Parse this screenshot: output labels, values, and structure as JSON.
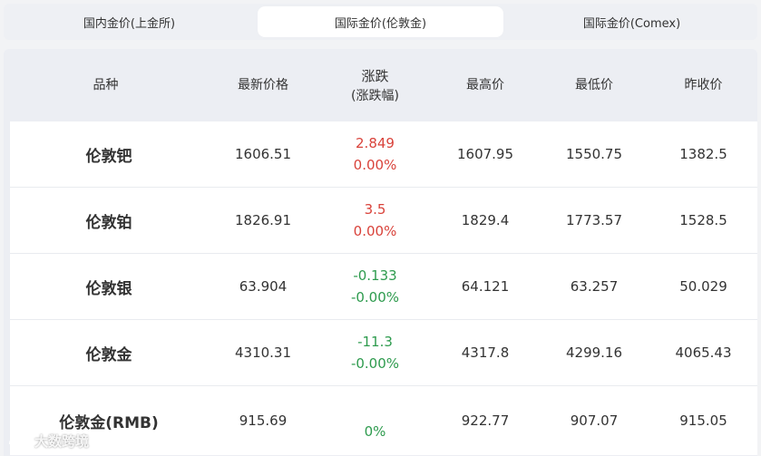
{
  "tabs": [
    {
      "label": "国内金价(上金所)",
      "active": false
    },
    {
      "label": "国际金价(伦敦金)",
      "active": true
    },
    {
      "label": "国际金价(Comex)",
      "active": false
    }
  ],
  "table": {
    "headers": {
      "name": "品种",
      "price": "最新价格",
      "change_line1": "涨跌",
      "change_line2": "(涨跌幅)",
      "high": "最高价",
      "low": "最低价",
      "prev": "昨收价"
    },
    "rows": [
      {
        "name": "伦敦钯",
        "price": "1606.51",
        "change": "2.849",
        "change_pct": "0.00%",
        "high": "1607.95",
        "low": "1550.75",
        "prev": "1382.5"
      },
      {
        "name": "伦敦铂",
        "price": "1826.91",
        "change": "3.5",
        "change_pct": "0.00%",
        "high": "1829.4",
        "low": "1773.57",
        "prev": "1528.5"
      },
      {
        "name": "伦敦银",
        "price": "63.904",
        "change": "-0.133",
        "change_pct": "-0.00%",
        "high": "64.121",
        "low": "63.257",
        "prev": "50.029"
      },
      {
        "name": "伦敦金",
        "price": "4310.31",
        "change": "-11.3",
        "change_pct": "-0.00%",
        "high": "4317.8",
        "low": "4299.16",
        "prev": "4065.43"
      },
      {
        "name": "伦敦金(RMB)",
        "price": "915.69",
        "change": "",
        "change_pct": "0%",
        "high": "922.77",
        "low": "907.07",
        "prev": "915.05"
      }
    ]
  },
  "watermark": {
    "text": "大数跨境"
  },
  "colors": {
    "up": "#d9433b",
    "down": "#2e9b4e",
    "background": "#f2f3f5"
  }
}
